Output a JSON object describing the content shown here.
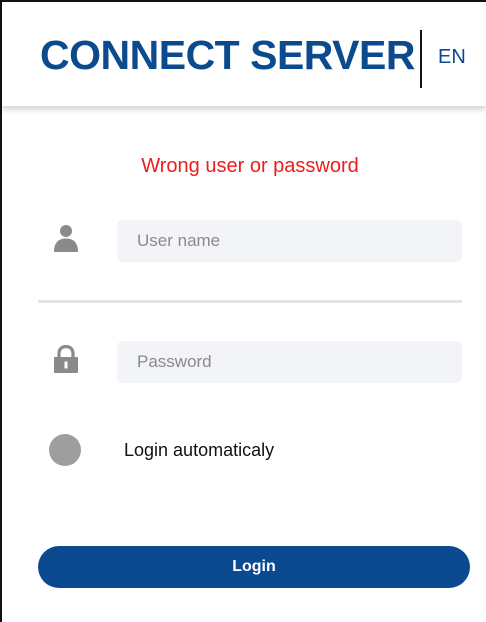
{
  "header": {
    "title": "CONNECT SERVER",
    "language_label": "EN"
  },
  "login_form": {
    "error_message": "Wrong user or password",
    "username": {
      "icon": "user-icon",
      "placeholder": "User name",
      "value": ""
    },
    "password": {
      "icon": "lock-icon",
      "placeholder": "Password",
      "value": ""
    },
    "auto_login": {
      "label": "Login automaticaly",
      "checked": false
    },
    "submit_label": "Login"
  },
  "colors": {
    "brand": "#0c4a8e",
    "button": "#0b4a91",
    "error": "#ee1c1c",
    "input_bg": "#f3f4f8",
    "icon": "#8a8a8a",
    "toggle_off": "#9e9e9e"
  }
}
